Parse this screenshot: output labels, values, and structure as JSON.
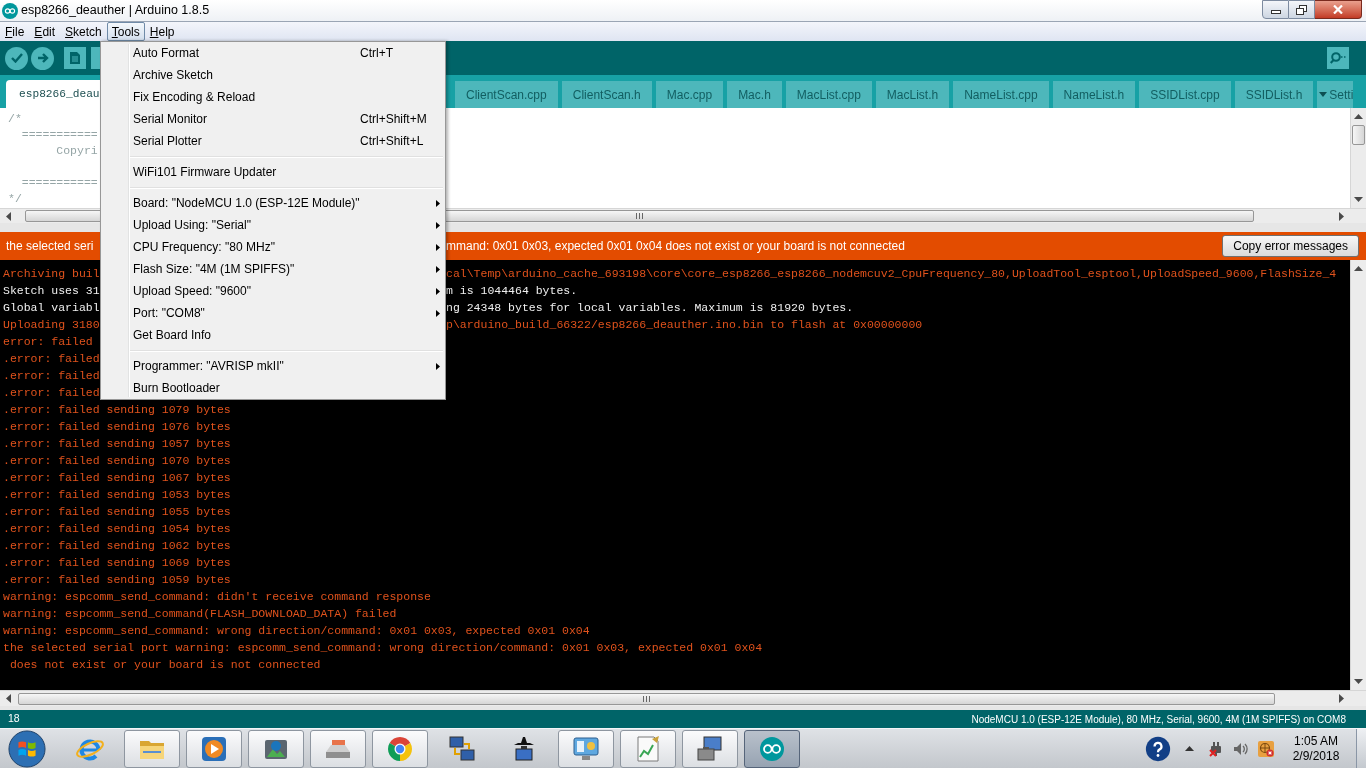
{
  "window": {
    "title": "esp8266_deauther | Arduino 1.8.5"
  },
  "menu_bar": [
    {
      "label": "File",
      "selected": false
    },
    {
      "label": "Edit",
      "selected": false
    },
    {
      "label": "Sketch",
      "selected": false
    },
    {
      "label": "Tools",
      "selected": true
    },
    {
      "label": "Help",
      "selected": false
    }
  ],
  "tools_menu": [
    {
      "kind": "item",
      "label": "Auto Format",
      "shortcut": "Ctrl+T"
    },
    {
      "kind": "item",
      "label": "Archive Sketch"
    },
    {
      "kind": "item",
      "label": "Fix Encoding & Reload"
    },
    {
      "kind": "item",
      "label": "Serial Monitor",
      "shortcut": "Ctrl+Shift+M"
    },
    {
      "kind": "item",
      "label": "Serial Plotter",
      "shortcut": "Ctrl+Shift+L"
    },
    {
      "kind": "separator"
    },
    {
      "kind": "item",
      "label": "WiFi101 Firmware Updater"
    },
    {
      "kind": "separator"
    },
    {
      "kind": "submenu",
      "label": "Board: \"NodeMCU 1.0 (ESP-12E Module)\""
    },
    {
      "kind": "submenu",
      "label": "Upload Using: \"Serial\""
    },
    {
      "kind": "submenu",
      "label": "CPU Frequency: \"80 MHz\""
    },
    {
      "kind": "submenu",
      "label": "Flash Size: \"4M (1M SPIFFS)\""
    },
    {
      "kind": "submenu",
      "label": "Upload Speed: \"9600\""
    },
    {
      "kind": "submenu",
      "label": "Port: \"COM8\""
    },
    {
      "kind": "item",
      "label": "Get Board Info"
    },
    {
      "kind": "separator"
    },
    {
      "kind": "submenu",
      "label": "Programmer: \"AVRISP mkII\""
    },
    {
      "kind": "item",
      "label": "Burn Bootloader"
    }
  ],
  "tabs": [
    {
      "label": "esp8266_deau",
      "selected": true
    },
    {
      "label": "ClientScan.cpp",
      "selected": false
    },
    {
      "label": "ClientScan.h",
      "selected": false
    },
    {
      "label": "Mac.cpp",
      "selected": false
    },
    {
      "label": "Mac.h",
      "selected": false
    },
    {
      "label": "MacList.cpp",
      "selected": false
    },
    {
      "label": "MacList.h",
      "selected": false
    },
    {
      "label": "NameList.cpp",
      "selected": false
    },
    {
      "label": "NameList.h",
      "selected": false
    },
    {
      "label": "SSIDList.cpp",
      "selected": false
    },
    {
      "label": "SSIDList.h",
      "selected": false
    },
    {
      "label": "Setti",
      "selected": false
    }
  ],
  "editor": {
    "lines": [
      {
        "kind": "code",
        "text": "/*"
      },
      {
        "kind": "code",
        "text": "  ==========="
      },
      {
        "kind": "code",
        "text": "       Copyri"
      },
      {
        "kind": "blank"
      },
      {
        "kind": "code",
        "text": "  ==========="
      },
      {
        "kind": "code",
        "text": "*/"
      }
    ]
  },
  "error_bar": {
    "message_start": "the selected seri",
    "message_end": "mmand: 0x01 0x03, expected 0x01 0x04 does not exist or your board is not connected",
    "copy_button": "Copy error messages"
  },
  "console": {
    "lines": [
      {
        "kind": "error",
        "left": "Archiving buil",
        "right": "cal\\Temp\\arduino_cache_693198\\core\\core_esp8266_esp8266_nodemcuv2_CpuFrequency_80,UploadTool_esptool,UploadSpeed_9600,FlashSize_4"
      },
      {
        "kind": "info",
        "left": "Sketch uses 31",
        "right": "m is 1044464 bytes."
      },
      {
        "kind": "info",
        "left": "Global variabl",
        "right": "ng 24348 bytes for local variables. Maximum is 81920 bytes."
      },
      {
        "kind": "error",
        "left": "Uploading 3180",
        "right": "p\\arduino_build_66322/esp8266_deauther.ino.bin to flash at 0x00000000"
      },
      {
        "kind": "error",
        "left": "error: failed"
      },
      {
        "kind": "error",
        "left": ".error: failed"
      },
      {
        "kind": "error",
        "left": ".error: failed"
      },
      {
        "kind": "error",
        "left": ".error: failed"
      },
      {
        "kind": "error",
        "text": ".error: failed sending 1079 bytes"
      },
      {
        "kind": "error",
        "text": ".error: failed sending 1076 bytes"
      },
      {
        "kind": "error",
        "text": ".error: failed sending 1057 bytes"
      },
      {
        "kind": "error",
        "text": ".error: failed sending 1070 bytes"
      },
      {
        "kind": "error",
        "text": ".error: failed sending 1067 bytes"
      },
      {
        "kind": "error",
        "text": ".error: failed sending 1053 bytes"
      },
      {
        "kind": "error",
        "text": ".error: failed sending 1055 bytes"
      },
      {
        "kind": "error",
        "text": ".error: failed sending 1054 bytes"
      },
      {
        "kind": "error",
        "text": ".error: failed sending 1062 bytes"
      },
      {
        "kind": "error",
        "text": ".error: failed sending 1069 bytes"
      },
      {
        "kind": "error",
        "text": ".error: failed sending 1059 bytes"
      },
      {
        "kind": "error",
        "text": "warning: espcomm_send_command: didn't receive command response"
      },
      {
        "kind": "error",
        "text": "warning: espcomm_send_command(FLASH_DOWNLOAD_DATA) failed"
      },
      {
        "kind": "error",
        "text": "warning: espcomm_send_command: wrong direction/command: 0x01 0x03, expected 0x01 0x04"
      },
      {
        "kind": "error",
        "text": "the selected serial port warning: espcomm_send_command: wrong direction/command: 0x01 0x03, expected 0x01 0x04"
      },
      {
        "kind": "error",
        "text": " does not exist or your board is not connected"
      }
    ]
  },
  "status_bar": {
    "line_number": "18",
    "board_info": "NodeMCU 1.0 (ESP-12E Module), 80 MHz, Serial, 9600, 4M (1M SPIFFS) on COM8"
  },
  "taskbar": {
    "items": [
      {
        "kind": "e-globe",
        "running": false,
        "active": false
      },
      {
        "kind": "folder",
        "running": true,
        "active": false
      },
      {
        "kind": "play",
        "running": true,
        "active": false
      },
      {
        "kind": "photo-box",
        "running": true,
        "active": false
      },
      {
        "kind": "scanner",
        "running": true,
        "active": false
      },
      {
        "kind": "segmented-circle",
        "running": true,
        "active": false
      },
      {
        "kind": "linked-monitors",
        "running": false,
        "active": false
      },
      {
        "kind": "hat-monitor",
        "running": false,
        "active": false
      },
      {
        "kind": "dashboard-monitor",
        "running": true,
        "active": false
      },
      {
        "kind": "chart-document",
        "running": true,
        "active": false
      },
      {
        "kind": "monitor-toolbox",
        "running": true,
        "active": false
      },
      {
        "kind": "infinity",
        "running": true,
        "active": true
      }
    ],
    "clock_time": "1:05 AM",
    "clock_date": "2/9/2018"
  }
}
